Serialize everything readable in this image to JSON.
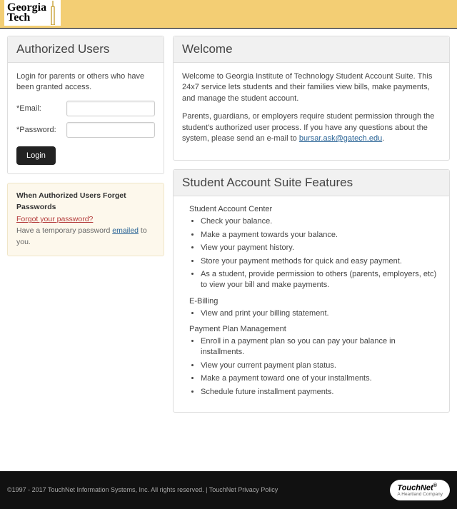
{
  "logo": {
    "line1": "Georgia",
    "line2": "Tech"
  },
  "login_panel": {
    "title": "Authorized Users",
    "intro": "Login for parents or others who have been granted access.",
    "email_label": "*Email:",
    "password_label": "*Password:",
    "email_value": "",
    "password_value": "",
    "button": "Login"
  },
  "help_panel": {
    "title": "When Authorized Users Forget Passwords",
    "forgot_link": "Forgot your password?",
    "temp_pre": "Have a temporary password ",
    "temp_link": "emailed",
    "temp_post": " to you."
  },
  "welcome_panel": {
    "title": "Welcome",
    "p1": "Welcome to Georgia Institute of Technology Student Account Suite. This 24x7 service lets students and their families view bills, make payments, and manage the student account.",
    "p2_pre": "Parents, guardians, or employers require student permission through the student's authorized user process. If you have any questions about the system, please send an e-mail to ",
    "p2_link": "bursar.ask@gatech.edu",
    "p2_post": "."
  },
  "features_panel": {
    "title": "Student Account Suite Features",
    "sac_head": "Student Account Center",
    "sac_items": [
      "Check your balance.",
      "Make a payment towards your balance.",
      "View your payment history.",
      "Store your payment methods for quick and easy payment.",
      "As a student, provide permission to others (parents, employers, etc) to view your bill and make payments."
    ],
    "eb_head": "E-Billing",
    "eb_items": [
      "View and print your billing statement."
    ],
    "ppm_head": "Payment Plan Management",
    "ppm_items": [
      "Enroll in a payment plan so you can pay your balance in installments.",
      "View your current payment plan status.",
      "Make a payment toward one of your installments.",
      "Schedule future installment payments."
    ]
  },
  "footer": {
    "copyright": "©1997 - 2017  TouchNet Information Systems, Inc. All rights reserved. | TouchNet Privacy Policy",
    "brand": "TouchNet",
    "brand_sub": "A Heartland Company"
  }
}
